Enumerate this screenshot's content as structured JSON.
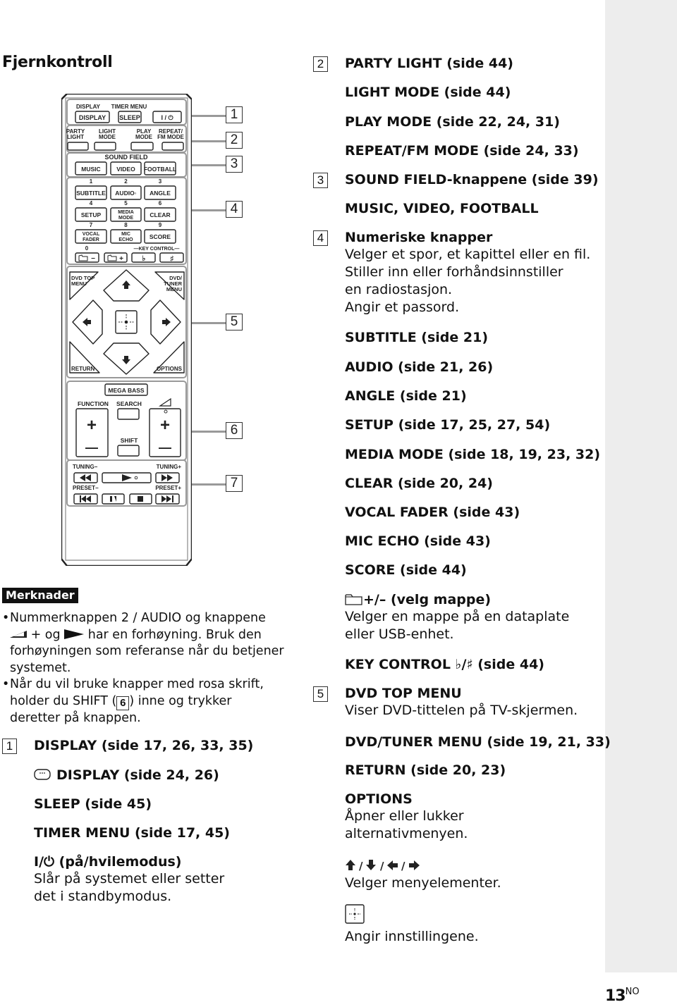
{
  "page": {
    "title": "Fjernkontroll",
    "page_number": "13",
    "page_suffix": "NO"
  },
  "remote": {
    "callouts": [
      "1",
      "2",
      "3",
      "4",
      "5",
      "6",
      "7"
    ],
    "row1_labels": {
      "display_small": "DISPLAY",
      "timer_menu": "TIMER MENU"
    },
    "row1_buttons": [
      "DISPLAY",
      "SLEEP",
      "I / ⏻"
    ],
    "row2_labels": [
      [
        "PARTY",
        "LIGHT"
      ],
      [
        "LIGHT",
        "MODE"
      ],
      [
        "PLAY",
        "MODE"
      ],
      [
        "REPEAT/",
        "FM MODE"
      ]
    ],
    "sound_field_label": "SOUND FIELD",
    "sound_field_buttons": [
      "MUSIC",
      "VIDEO",
      "FOOTBALL"
    ],
    "numpad": [
      {
        "num": "1",
        "label": [
          "SUBTITLE"
        ]
      },
      {
        "num": "2",
        "label": [
          "AUDIO◦"
        ]
      },
      {
        "num": "3",
        "label": [
          "ANGLE"
        ]
      },
      {
        "num": "4",
        "label": [
          "SETUP"
        ]
      },
      {
        "num": "5",
        "label": [
          "MEDIA",
          "MODE"
        ]
      },
      {
        "num": "6",
        "label": [
          "CLEAR"
        ]
      },
      {
        "num": "7",
        "label": [
          "VOCAL",
          "FADER"
        ]
      },
      {
        "num": "8",
        "label": [
          "MIC",
          "ECHO"
        ]
      },
      {
        "num": "9",
        "label": [
          "SCORE"
        ]
      }
    ],
    "zero_label": "0",
    "key_control_label": "KEY CONTROL",
    "bottom_row": [
      "−",
      "+",
      "♭",
      "♯"
    ],
    "nav": {
      "dvd_top_menu": [
        "DVD TOP",
        "MENU"
      ],
      "dvd_tuner_menu": [
        "DVD/",
        "TUNER",
        "MENU"
      ],
      "return": "RETURN",
      "options": "OPTIONS"
    },
    "mega_bass": "MEGA BASS",
    "function": "FUNCTION",
    "search": "SEARCH",
    "shift": "SHIFT",
    "tuning_minus": "TUNING−",
    "tuning_plus": "TUNING+",
    "preset_minus": "PRESET−",
    "preset_plus": "PRESET+"
  },
  "notes": {
    "badge": "Merknader",
    "items": [
      {
        "parts": [
          "Nummerknappen 2 / AUDIO og knappene ",
          " + og ",
          " har en forhøyning. Bruk den forhøyningen som referanse når du betjener systemet."
        ]
      },
      {
        "parts": [
          "Når du vil bruke knapper med rosa skrift, holder du SHIFT (",
          ") inne og trykker deretter på knappen."
        ],
        "ref": "6"
      }
    ]
  },
  "sections": {
    "s1": {
      "num": "1",
      "entries": [
        {
          "title": "DISPLAY (side 17, 26, 33, 35)"
        },
        {
          "title": "DISPLAY (side 24, 26)",
          "icon": "display-button-icon"
        },
        {
          "title": "SLEEP (side 45)"
        },
        {
          "title": "TIMER MENU (side 17, 45)"
        },
        {
          "title": "I/⏻ (på/hvilemodus)",
          "desc": [
            "Slår på systemet eller setter",
            "det i standbymodus."
          ]
        }
      ]
    },
    "s2": {
      "num": "2",
      "entries": [
        {
          "title": "PARTY LIGHT (side 44)"
        },
        {
          "title": "LIGHT MODE (side 44)"
        },
        {
          "title": "PLAY MODE (side 22, 24, 31)"
        },
        {
          "title": "REPEAT/FM MODE (side 24, 33)"
        }
      ]
    },
    "s3": {
      "num": "3",
      "entries": [
        {
          "title": "SOUND FIELD-knappene (side 39)"
        },
        {
          "title": "MUSIC, VIDEO, FOOTBALL"
        }
      ]
    },
    "s4": {
      "num": "4",
      "entries": [
        {
          "title": "Numeriske knapper",
          "desc": [
            "Velger et spor, et kapittel eller en fil.",
            "Stiller inn eller forhåndsinnstiller",
            "en radiostasjon.",
            "Angir et passord."
          ]
        },
        {
          "title": "SUBTITLE (side 21)"
        },
        {
          "title": "AUDIO (side 21, 26)"
        },
        {
          "title": "ANGLE (side 21)"
        },
        {
          "title": "SETUP (side 17, 25, 27, 54)"
        },
        {
          "title": "MEDIA MODE (side 18, 19, 23, 32)"
        },
        {
          "title": "CLEAR (side 20, 24)"
        },
        {
          "title": "VOCAL FADER (side 43)"
        },
        {
          "title": "MIC ECHO (side 43)"
        },
        {
          "title": "SCORE (side 44)"
        },
        {
          "title": "+/– (velg mappe)",
          "icon": "folder-icon",
          "desc": [
            "Velger en mappe på en dataplate",
            "eller USB-enhet."
          ]
        },
        {
          "title": "KEY CONTROL ♭/♯ (side 44)"
        }
      ]
    },
    "s5": {
      "num": "5",
      "entries": [
        {
          "title": "DVD TOP MENU",
          "desc": [
            "Viser DVD-tittelen på TV-skjermen."
          ]
        },
        {
          "title": "DVD/TUNER MENU (side 19, 21, 33)"
        },
        {
          "title": "RETURN (side 20, 23)"
        },
        {
          "title": "OPTIONS",
          "desc": [
            "Åpner eller lukker",
            "alternativmenyen."
          ]
        },
        {
          "title": "↑ / ↓ / ← / →",
          "desc": [
            "Velger menyelementer."
          ]
        },
        {
          "title": "",
          "icon": "enter-button-icon",
          "desc": [
            "Angir innstillingene."
          ]
        }
      ]
    }
  }
}
